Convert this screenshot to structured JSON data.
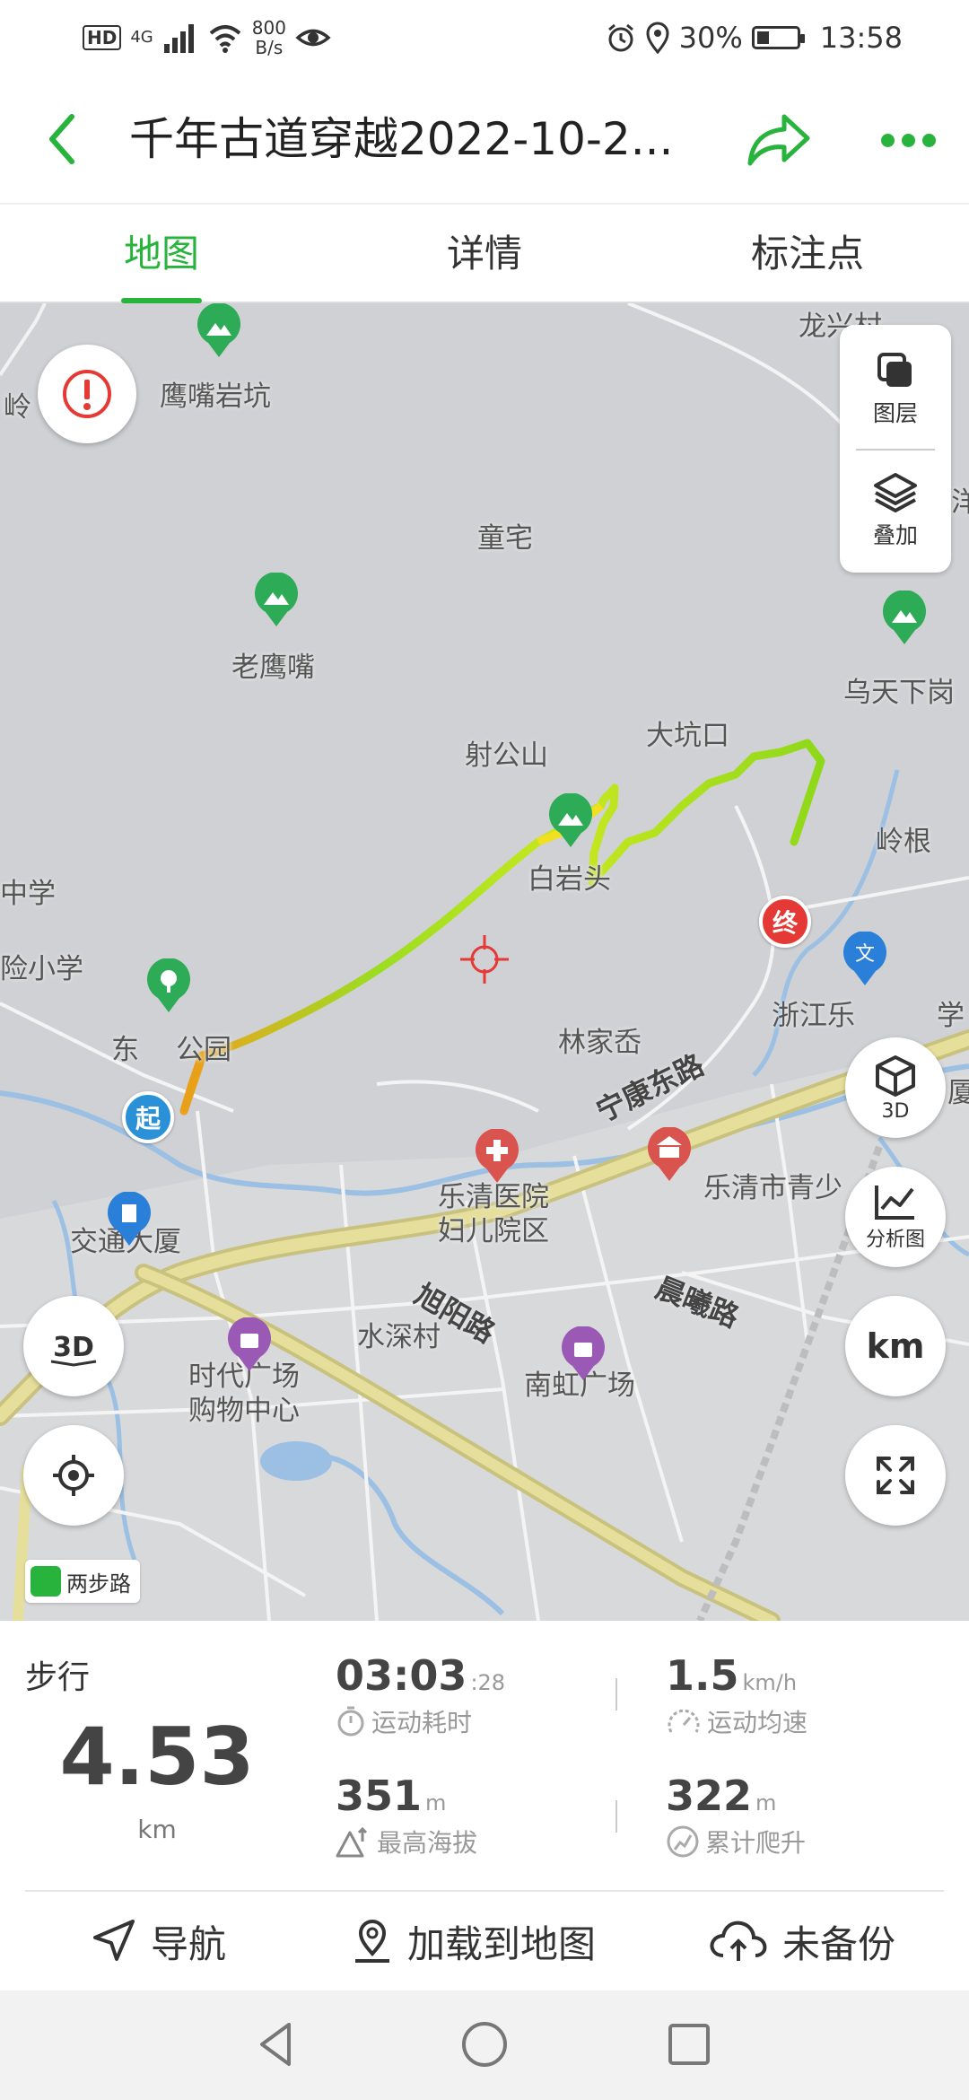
{
  "status_bar": {
    "hd": "HD",
    "network": "4G",
    "speed_value": "800",
    "speed_unit": "B/s",
    "battery": "30%",
    "battery_fill": 0.3,
    "time": "13:58"
  },
  "header": {
    "title": "千年古道穿越2022-10-2..."
  },
  "tabs": [
    {
      "label": "地图",
      "active": true
    },
    {
      "label": "详情",
      "active": false
    },
    {
      "label": "标注点",
      "active": false
    }
  ],
  "map": {
    "places": {
      "yingzuiyankeng": "鹰嘴岩坑",
      "longxingcun": "龙兴村",
      "ling": "岭",
      "tongzhai": "童宅",
      "yang": "洋",
      "laoyingzui": "老鹰嘴",
      "wutianxiagang": "乌天下岗",
      "sheshan": "射公山",
      "dakengkou": "大坑口",
      "baiyantou": "白岩头",
      "linggen": "岭根",
      "zhongxue": "中学",
      "xiaoxue": "险小学",
      "zhejiang": "浙江乐",
      "xue": "学",
      "linjiacun": "林家岙",
      "dong_park_a": "东",
      "dong_park_b": "公园",
      "ningkang_road": "宁康东路",
      "hospital_a": "乐清医院",
      "hospital_b": "妇儿院区",
      "qingshao": "乐清市青少",
      "jiaotong": "交通大厦",
      "xuyang_road": "旭阳路",
      "chenxi_road": "晨曦路",
      "shuishen": "水深村",
      "shidai_a": "时代广场",
      "shidai_b": "购物中心",
      "nanhong": "南虹广场",
      "sha": "厦"
    },
    "layer_button": "图层",
    "overlay_button": "叠加",
    "btn_3d": "3D",
    "btn_analysis": "分析图",
    "btn_km": "km",
    "start_marker": "起",
    "end_marker": "终",
    "provider": "两步路"
  },
  "stats": {
    "sport_type": "步行",
    "distance": "4.53",
    "distance_unit": "km",
    "duration_main": "03:03",
    "duration_sec": ":28",
    "duration_label": "运动耗时",
    "avg_speed": "1.5",
    "avg_speed_unit": "km/h",
    "avg_speed_label": "运动均速",
    "max_altitude": "351",
    "max_altitude_unit": "m",
    "max_altitude_label": "最高海拔",
    "total_climb": "322",
    "total_climb_unit": "m",
    "total_climb_label": "累计爬升"
  },
  "actions": {
    "navigate": "导航",
    "load_to_map": "加载到地图",
    "backup": "未备份"
  },
  "colors": {
    "accent": "#27b33c",
    "start": "#2a91d8",
    "end": "#e53935"
  }
}
